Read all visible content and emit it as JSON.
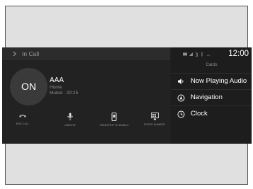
{
  "header": {
    "title": "In Call"
  },
  "caller": {
    "avatar_text": "ON",
    "name": "AAA",
    "type": "Home",
    "status": "Muted · 00:25"
  },
  "controls": [
    {
      "label": "END CALL",
      "icon": "phone-hangup-icon"
    },
    {
      "label": "UNMUTE",
      "icon": "microphone-icon"
    },
    {
      "label": "TRANSFER TO MOBILE",
      "icon": "mobile-phone-icon"
    },
    {
      "label": "ENTER NUMBER",
      "icon": "keypad-icon"
    }
  ],
  "status_bar": {
    "time": "12:00",
    "icons": [
      "battery-icon",
      "signal-icon",
      "bluetooth-icon",
      "network-icon",
      "wifi-icon"
    ]
  },
  "cards": {
    "title": "Cards",
    "items": [
      {
        "label": "Now Playing Audio",
        "icon": "speaker-icon"
      },
      {
        "label": "Navigation",
        "icon": "navigation-icon"
      },
      {
        "label": "Clock",
        "icon": "clock-icon"
      }
    ]
  },
  "colors": {
    "screen_bg": "#1f1f1f",
    "panel_bg": "#222222",
    "text": "#ffffff",
    "muted_text": "#8e8e8e",
    "frame_bg": "#e0e0e0"
  }
}
